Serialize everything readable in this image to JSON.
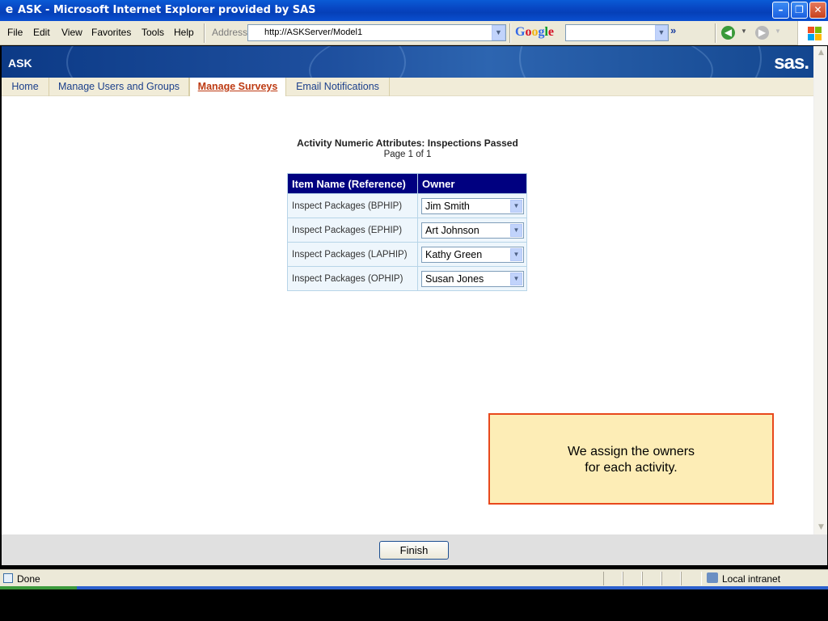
{
  "window": {
    "title": "ASK - Microsoft Internet Explorer provided by SAS",
    "minimize": "–",
    "maximize": "❐",
    "close": "✕"
  },
  "menu": {
    "items": [
      "File",
      "Edit",
      "View",
      "Favorites",
      "Tools",
      "Help"
    ],
    "address_label": "Address",
    "address_value": "http://ASKServer/Model1",
    "search_brand": "Google",
    "search_value": "",
    "more": "»"
  },
  "app": {
    "brand": "ASK",
    "vendor_logo": "sas.",
    "tabs": [
      {
        "label": "Home",
        "active": false
      },
      {
        "label": "Manage Users and Groups",
        "active": false
      },
      {
        "label": "Manage Surveys",
        "active": true
      },
      {
        "label": "Email Notifications",
        "active": false
      }
    ]
  },
  "page": {
    "heading": "Activity Numeric Attributes: Inspections Passed",
    "page_info": "Page 1 of 1",
    "columns": [
      "Item Name (Reference)",
      "Owner"
    ],
    "rows": [
      {
        "item": "Inspect Packages (BPHIP)",
        "owner": "Jim Smith"
      },
      {
        "item": "Inspect Packages (EPHIP)",
        "owner": "Art Johnson"
      },
      {
        "item": "Inspect Packages (LAPHIP)",
        "owner": "Kathy Green"
      },
      {
        "item": "Inspect Packages (OPHIP)",
        "owner": "Susan Jones"
      }
    ],
    "callout_line1": "We assign the owners",
    "callout_line2": "for each activity.",
    "finish_label": "Finish"
  },
  "status": {
    "text": "Done",
    "zone": "Local intranet"
  },
  "colors": {
    "header_bg": "#000080",
    "active_tab": "#bd3a12",
    "callout_border": "#e8481c",
    "callout_bg": "#fdedb6"
  }
}
